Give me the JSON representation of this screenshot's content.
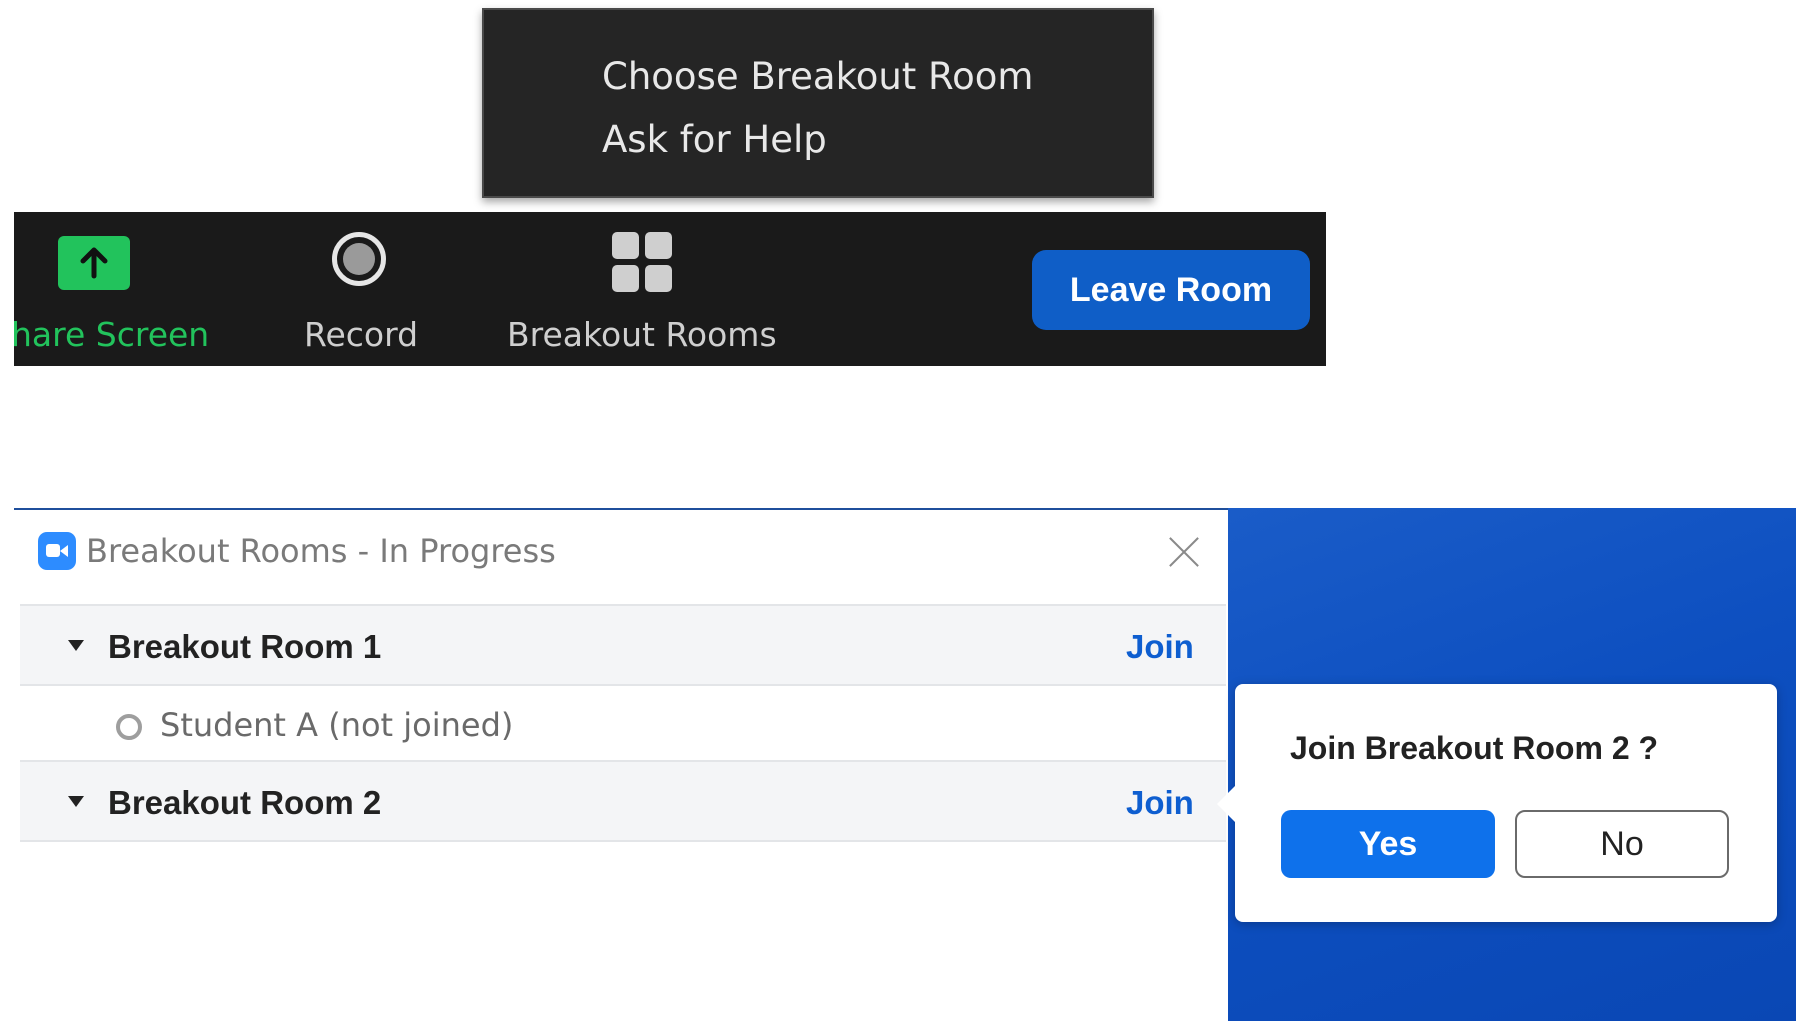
{
  "context_menu": {
    "items": [
      {
        "label": "Choose Breakout Room"
      },
      {
        "label": "Ask for Help"
      }
    ]
  },
  "toolbar": {
    "share_screen_label": "hare Screen",
    "share_screen_color": "#22c35c",
    "record_label": "Record",
    "breakout_rooms_label": "Breakout Rooms",
    "leave_room_label": "Leave Room",
    "leave_room_color": "#0f5ec7"
  },
  "breakout_window": {
    "title": "Breakout Rooms - In Progress",
    "rooms": [
      {
        "name": "Breakout Room 1",
        "join_label": "Join",
        "members": [
          {
            "name": "Student A (not joined)"
          }
        ]
      },
      {
        "name": "Breakout Room 2",
        "join_label": "Join",
        "members": []
      }
    ]
  },
  "join_popover": {
    "question": "Join Breakout Room 2 ?",
    "yes_label": "Yes",
    "no_label": "No",
    "yes_color": "#0e71eb"
  }
}
